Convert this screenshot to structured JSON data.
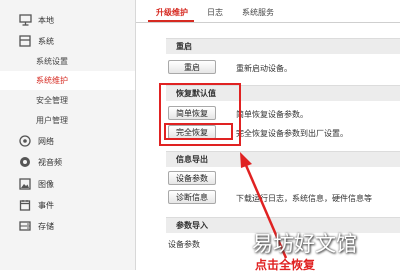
{
  "sidebar": {
    "items": [
      {
        "label": "本地",
        "icon": "monitor-icon"
      },
      {
        "label": "系统",
        "icon": "system-icon"
      },
      {
        "label": "网络",
        "icon": "globe-icon"
      },
      {
        "label": "视音频",
        "icon": "video-audio-icon"
      },
      {
        "label": "图像",
        "icon": "image-icon"
      },
      {
        "label": "事件",
        "icon": "event-icon"
      },
      {
        "label": "存储",
        "icon": "storage-icon"
      }
    ],
    "subitems": [
      "系统设置",
      "系统维护",
      "安全管理",
      "用户管理"
    ],
    "active_subitem": "系统维护"
  },
  "tabs": [
    "升级维护",
    "日志",
    "系统服务"
  ],
  "active_tab": "升级维护",
  "sections": {
    "restart": {
      "title": "重启",
      "button": "重启",
      "desc": "重新启动设备。"
    },
    "restore": {
      "title": "恢复默认值",
      "simple_button": "简单恢复",
      "simple_desc": "简单恢复设备参数。",
      "full_button": "完全恢复",
      "full_desc": "完全恢复设备参数到出厂设置。"
    },
    "export": {
      "title": "信息导出",
      "params_button": "设备参数",
      "diag_button": "诊断信息",
      "diag_desc": "下载运行日志，系统信息，硬件信息等"
    },
    "import": {
      "title": "参数导入",
      "label": "设备参数"
    }
  },
  "watermark": "易坊好文馆",
  "annotation_text": "点击全恢复",
  "colors": {
    "accent": "#d62a21",
    "highlight_box": "#e02222"
  }
}
